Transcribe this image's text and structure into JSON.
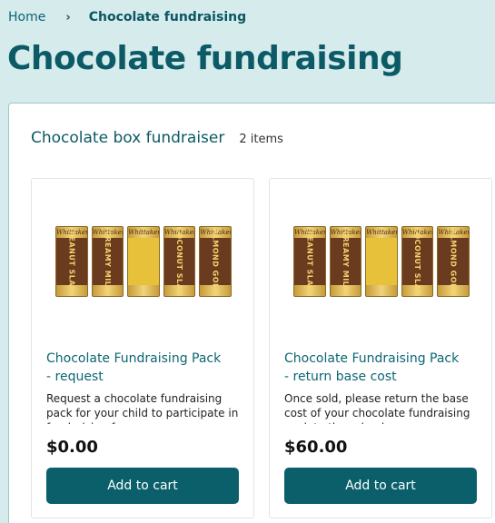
{
  "breadcrumb": {
    "home": "Home",
    "separator": "›",
    "current": "Chocolate fundraising"
  },
  "page_title": "Chocolate fundraising",
  "section": {
    "title": "Chocolate box fundraiser",
    "count": "2 items"
  },
  "products": [
    {
      "title": "Chocolate Fundraising Pack - request",
      "description": "Request a chocolate fundraising pack for your child to participate in fundraising for camp",
      "price": "$0.00",
      "button": "Add to cart"
    },
    {
      "title": "Chocolate Fundraising Pack - return base cost",
      "description": "Once sold, please return the base cost of your chocolate fundraising pack to the school",
      "price": "$60.00",
      "button": "Add to cart"
    }
  ],
  "bars": [
    {
      "label": "PEANUT SLAB",
      "style": "dark"
    },
    {
      "label": "CREAMY MILK",
      "style": "dark"
    },
    {
      "label": "",
      "style": "yellow"
    },
    {
      "label": "COCONUT SLAB",
      "style": "dark"
    },
    {
      "label": "ALMOND GOLD",
      "style": "dark"
    }
  ],
  "bar_brand": "Whittaker's",
  "colors": {
    "background": "#d5ebec",
    "accent": "#0a5f6b",
    "link": "#0b6673"
  }
}
